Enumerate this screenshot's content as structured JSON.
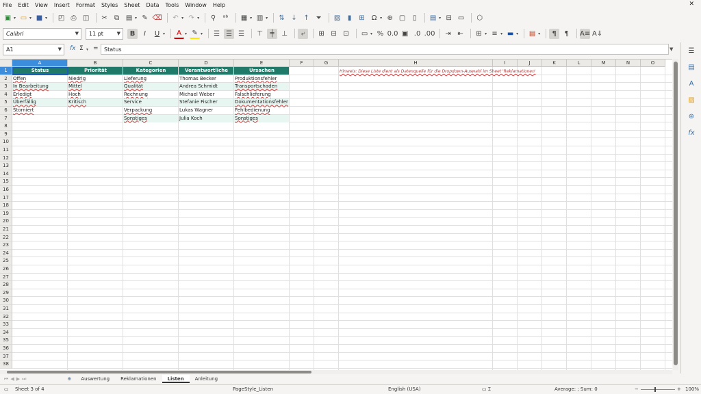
{
  "menu": [
    "File",
    "Edit",
    "View",
    "Insert",
    "Format",
    "Styles",
    "Sheet",
    "Data",
    "Tools",
    "Window",
    "Help"
  ],
  "font": {
    "name": "Calibri",
    "size": "11 pt"
  },
  "name_box": "A1",
  "formula_content": "Status",
  "formula_symbols": {
    "fx": "fx",
    "sigma": "Σ",
    "equals": "="
  },
  "columns": [
    "A",
    "B",
    "C",
    "D",
    "E",
    "F",
    "G",
    "H",
    "I",
    "J",
    "K",
    "L",
    "M",
    "N",
    "O"
  ],
  "rows": [
    "1",
    "2",
    "3",
    "4",
    "5",
    "6",
    "7",
    "8",
    "9",
    "10",
    "11",
    "12",
    "13",
    "14",
    "15",
    "16",
    "17",
    "18",
    "19",
    "20",
    "21",
    "22",
    "23",
    "24",
    "25",
    "26",
    "27",
    "28",
    "29",
    "30",
    "31",
    "32",
    "33",
    "34",
    "35",
    "36",
    "37",
    "38"
  ],
  "headers": [
    "Status",
    "Priorität",
    "Kategorien",
    "Verantwortliche",
    "Ursachen"
  ],
  "table": {
    "status": [
      "Offen",
      "In Bearbeitung",
      "Erledigt",
      "Überfällig",
      "Storniert"
    ],
    "prioritaet": [
      "Niedrig",
      "Mittel",
      "Hoch",
      "Kritisch"
    ],
    "kategorien": [
      "Lieferung",
      "Qualität",
      "Rechnung",
      "Service",
      "Verpackung",
      "Sonstiges"
    ],
    "verantwortliche": [
      "Thomas Becker",
      "Andrea Schmidt",
      "Michael Weber",
      "Stefanie Fischer",
      "Lukas Wagner",
      "Julia Koch"
    ],
    "ursachen": [
      "Produktionsfehler",
      "Transportschaden",
      "Falschlieferung",
      "Dokumentationsfehler",
      "Fehlbedienung",
      "Sonstiges"
    ]
  },
  "note": "Hinweis: Diese Liste dient als Datenquelle für die Dropdown-Auswahl im Sheet 'Reklamationen'",
  "tabs": [
    "Auswertung",
    "Reklamationen",
    "Listen",
    "Anleitung"
  ],
  "active_tab": "Listen",
  "status_bar": {
    "sheet": "Sheet 3 of 4",
    "page_style": "PageStyle_Listen",
    "language": "English (USA)",
    "summary": "Average: ; Sum: 0",
    "zoom": "100%"
  },
  "icons": {
    "toolbar1": [
      "new-icon",
      "open-icon",
      "save-icon",
      "export-pdf-icon",
      "print-icon",
      "print-preview-icon",
      "cut-icon",
      "copy-icon",
      "paste-icon",
      "clone-icon",
      "clear-icon",
      "undo-icon",
      "redo-icon",
      "find-icon",
      "spelling-icon",
      "row-icon",
      "column-icon",
      "sort-icon",
      "sort-asc-icon",
      "sort-desc-icon",
      "autofilter-icon",
      "image-icon",
      "chart-icon",
      "pivot-icon",
      "special-char-icon",
      "hyperlink-icon",
      "comment-icon",
      "header-footer-icon",
      "define-print-area-icon",
      "freeze-icon",
      "split-icon",
      "show-draw-icon"
    ]
  }
}
